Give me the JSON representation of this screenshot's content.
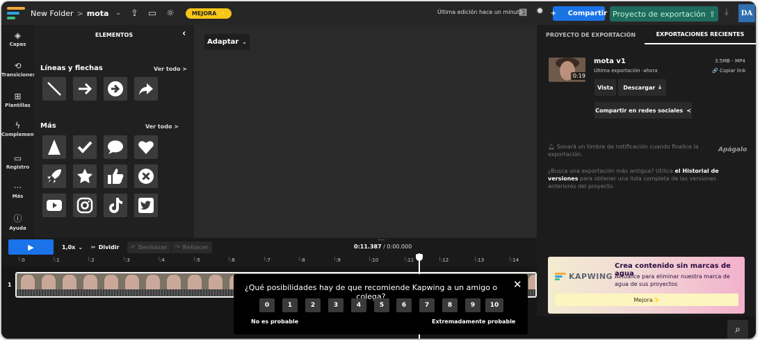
{
  "topbar": {
    "folder": "New Folder",
    "separator": ">",
    "project": "mota",
    "upgrade_label": "MEJORA",
    "last_edit": "Última edición hace un minuto",
    "share_label": "Compartir",
    "export_label": "Proyecto de exportación",
    "avatar_initials": "DA"
  },
  "rail": {
    "items": [
      {
        "label": "Capas",
        "icon": "layers-icon"
      },
      {
        "label": "Transiciones",
        "icon": "transitions-icon"
      },
      {
        "label": "Plantillas",
        "icon": "templates-icon"
      },
      {
        "label": "Complemento",
        "icon": "plugin-icon"
      },
      {
        "label": "Registro",
        "icon": "record-icon"
      },
      {
        "label": "Más",
        "icon": "more-icon"
      },
      {
        "label": "Ayuda",
        "icon": "help-icon"
      }
    ]
  },
  "elements_panel": {
    "title": "ELEMENTOS",
    "sections": [
      {
        "title": "Líneas y flechas",
        "view_all": "Ver todo >",
        "items": [
          "line",
          "arrow-right",
          "arrow-circle",
          "arrow-share"
        ]
      },
      {
        "title": "Más",
        "view_all": "Ver todo >",
        "items": [
          "triangle",
          "checkmark",
          "speech-bubble",
          "heart",
          "rocket",
          "star",
          "thumbs-up",
          "x-circle",
          "youtube",
          "instagram",
          "tiktok",
          "twitter"
        ]
      }
    ]
  },
  "canvas": {
    "fit_label": "Adaptar"
  },
  "export_panel": {
    "tab_project": "PROYECTO DE EXPORTACIÓN",
    "tab_recent": "EXPORTACIONES RECIENTES",
    "video_name": "mota v1",
    "video_meta": "3.5MB - MP4",
    "video_when": "Última exportación -ahora",
    "duration": "0:19",
    "copy_link": "Copiar link",
    "view_label": "Vista",
    "download_label": "Descargar",
    "social_label": "Compartir en redes sociales",
    "notify_text": "Sonará un timbre de notificación cuando finalice la exportación.",
    "mute_label": "Apágalo",
    "history_pre": "¿Busca una exportación más antigua? Utilice ",
    "history_link": "el Historial de versiones",
    "history_post": " para obtener una lista completa de las versiones anteriores del proyecto."
  },
  "promo": {
    "logo_text": "KAPWING",
    "title": "Crea contenido sin marcas de agua",
    "text": "Actualice para eliminar nuestra marca de agua de sus proyectos",
    "button": "Mejora"
  },
  "timeline": {
    "speed": "1,0x",
    "split": "Dividir",
    "undo": "Deshacer",
    "redo": "Rehacer",
    "current_time": "0:11.387",
    "total_time": "/ 0:00.000",
    "ruler_ticks": [
      ":0",
      ":1",
      ":2",
      ":3",
      ":4",
      ":5",
      ":6",
      ":7",
      ":8",
      ":9",
      ":10",
      ":11",
      ":12",
      ":13",
      ":14"
    ],
    "track_number": "1"
  },
  "survey": {
    "question": "¿Qué posibilidades hay de que recomiende Kapwing a un amigo o colega?",
    "scores": [
      "0",
      "1",
      "2",
      "3",
      "4",
      "5",
      "6",
      "7",
      "8",
      "9",
      "10"
    ],
    "low_label": "No es probable",
    "high_label": "Extremadamente probable"
  },
  "colors": {
    "accent_blue": "#1a73e8",
    "export_green": "#1f6b5e",
    "upgrade_yellow": "#f5c518"
  }
}
